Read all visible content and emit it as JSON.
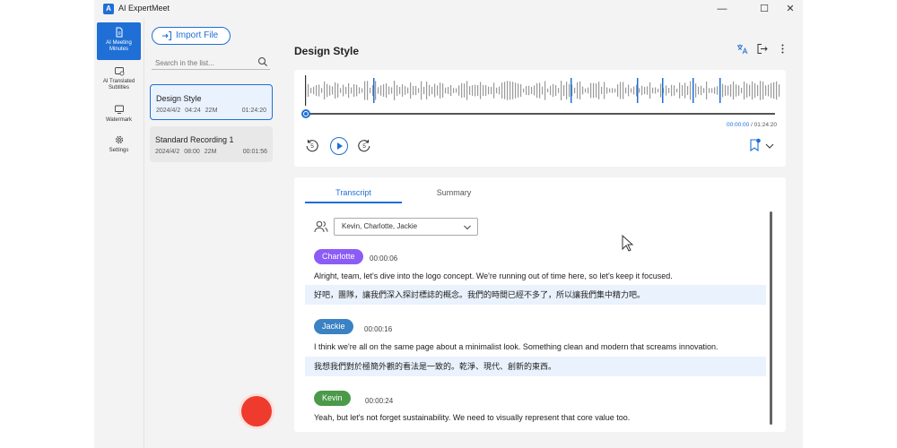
{
  "app": {
    "title": "AI ExpertMeet",
    "logo_letter": "A"
  },
  "window_controls": {
    "minimize": "—",
    "maximize": "☐",
    "close": "✕"
  },
  "rail": {
    "items": [
      {
        "label": "AI Meeting Minutes",
        "icon": "document-icon",
        "active": true
      },
      {
        "label": "AI Translated Subtitles",
        "icon": "subtitles-icon",
        "active": false
      },
      {
        "label": "Watermark",
        "icon": "monitor-icon",
        "active": false
      },
      {
        "label": "Settings",
        "icon": "gear-icon",
        "active": false
      }
    ]
  },
  "list": {
    "import_label": "Import File",
    "search_placeholder": "Search in the list...",
    "recordings": [
      {
        "name": "Design Style",
        "date": "2024/4/2",
        "time": "04:24",
        "size": "22M",
        "duration": "01:24:20",
        "selected": true
      },
      {
        "name": "Standard Recording 1",
        "date": "2024/4/2",
        "time": "08:00",
        "size": "22M",
        "duration": "00:01:56",
        "selected": false
      }
    ]
  },
  "main": {
    "title": "Design Style",
    "player": {
      "current_time": "00:00:00",
      "total_time": " / 01:24:20",
      "progress": 0.0,
      "skip_back_label": "5",
      "skip_forward_label": "5"
    },
    "tabs": [
      {
        "label": "Transcript",
        "active": true
      },
      {
        "label": "Summary",
        "active": false
      }
    ],
    "speaker_filter": "Kevin, Charlotte, Jackie",
    "entries": [
      {
        "speaker": "Charlotte",
        "color": "#8b5cf6",
        "time": "00:00:06",
        "en": "Alright, team, let's dive into the logo concept. We're running out of time here, so let's keep it focused.",
        "zh": "好吧，團隊，讓我們深入探討標誌的概念。我們的時間已經不多了，所以讓我們集中精力吧。"
      },
      {
        "speaker": "Jackie",
        "color": "#3b82c4",
        "time": "00:00:16",
        "en": "I think we're all on the same page about a minimalist look. Something clean and modern that screams innovation.",
        "zh": "我想我們對於極簡外觀的看法是一致的。乾淨、現代、創新的東西。"
      },
      {
        "speaker": "Kevin",
        "color": "#4a9a4a",
        "time": "00:00:24",
        "en": "Yeah, but let's not forget sustainability. We need to visually represent that core value too.",
        "zh": ""
      }
    ]
  },
  "colors": {
    "accent": "#1f6fd6",
    "record": "#ef3b2d"
  }
}
